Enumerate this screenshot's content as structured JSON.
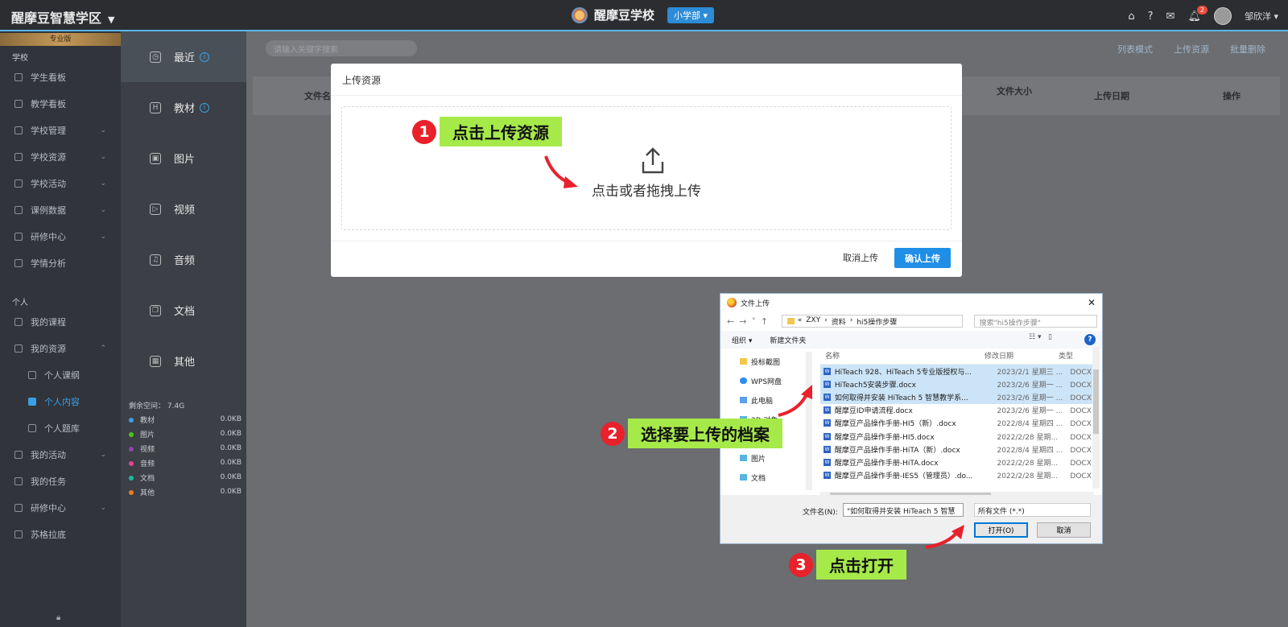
{
  "header": {
    "brand": "醒摩豆智慧学区",
    "school": "醒摩豆学校",
    "dept": "小学部",
    "notification_count": "2",
    "user": "邹欣洋"
  },
  "sidebar": {
    "edition": "专业版",
    "section_school": "学校",
    "school_items": [
      "学生看板",
      "教学看板",
      "学校管理",
      "学校资源",
      "学校活动",
      "课例数据",
      "研修中心",
      "学情分析"
    ],
    "section_personal": "个人",
    "personal_items": [
      "我的课程",
      "我的资源"
    ],
    "sub_items": [
      "个人课纲",
      "个人内容",
      "个人题库"
    ],
    "more_items": [
      "我的活动",
      "我的任务",
      "研修中心",
      "苏格拉底"
    ]
  },
  "categories": [
    "最近",
    "教材",
    "图片",
    "视频",
    "音频",
    "文档",
    "其他"
  ],
  "storage": {
    "label": "剩余空间：",
    "value": "7.4G",
    "rows": [
      {
        "name": "教材",
        "size": "0.0KB",
        "color": "#3aa0e8"
      },
      {
        "name": "图片",
        "size": "0.0KB",
        "color": "#52c41a"
      },
      {
        "name": "视频",
        "size": "0.0KB",
        "color": "#8e44ad"
      },
      {
        "name": "音频",
        "size": "0.0KB",
        "color": "#e84393"
      },
      {
        "name": "文档",
        "size": "0.0KB",
        "color": "#1abc9c"
      },
      {
        "name": "其他",
        "size": "0.0KB",
        "color": "#e67e22"
      }
    ]
  },
  "toolbar": {
    "search_placeholder": "请输入关键字搜索",
    "list_mode": "列表模式",
    "upload": "上传资源",
    "batch_delete": "批量删除"
  },
  "table": {
    "col_name": "文件名",
    "col_size": "文件大小",
    "col_date": "上传日期",
    "col_action": "操作"
  },
  "modal": {
    "title": "上传资源",
    "drop_text": "点击或者拖拽上传",
    "cancel": "取消上传",
    "confirm": "确认上传"
  },
  "callouts": {
    "step1_num": "1",
    "step1": "点击上传资源",
    "step2_num": "2",
    "step2": "选择要上传的档案",
    "step3_num": "3",
    "step3": "点击打开"
  },
  "file_dialog": {
    "title": "文件上传",
    "path": [
      "«",
      "ZXY",
      "›",
      "资料",
      "›",
      "hi5操作步骤"
    ],
    "search_placeholder": "搜索\"hi5操作步骤\"",
    "organize": "组织 ▾",
    "new_folder": "新建文件夹",
    "tree": [
      "投标截图",
      "WPS网盘",
      "此电脑",
      "3D 对象",
      "视频",
      "图片",
      "文档"
    ],
    "col_name": "名称",
    "col_date": "修改日期",
    "col_type": "类型",
    "files": [
      {
        "name": "HiTeach 928、HiTeach 5专业版授权与...",
        "date": "2023/2/1 星期三 ...",
        "type": "DOCX 文",
        "selected": true
      },
      {
        "name": "HiTeach5安装步骤.docx",
        "date": "2023/2/6 星期一 ...",
        "type": "DOCX 文",
        "selected": true
      },
      {
        "name": "如何取得并安装 HiTeach 5 智慧教学系...",
        "date": "2023/2/6 星期一 ...",
        "type": "DOCX 文",
        "selected": true
      },
      {
        "name": "醒摩豆ID申请流程.docx",
        "date": "2023/2/6 星期一 ...",
        "type": "DOCX 文",
        "selected": false
      },
      {
        "name": "醒摩豆产品操作手册-HI5（新）.docx",
        "date": "2022/8/4 星期四 ...",
        "type": "DOCX 文",
        "selected": false
      },
      {
        "name": "醒摩豆产品操作手册-HI5.docx",
        "date": "2022/2/28 星期...",
        "type": "DOCX 文",
        "selected": false
      },
      {
        "name": "醒摩豆产品操作手册-HiTA（新）.docx",
        "date": "2022/8/4 星期四 ...",
        "type": "DOCX 文",
        "selected": false
      },
      {
        "name": "醒摩豆产品操作手册-HiTA.docx",
        "date": "2022/2/28 星期...",
        "type": "DOCX 文",
        "selected": false
      },
      {
        "name": "醒摩豆产品操作手册-IES5（管理员）.do...",
        "date": "2022/2/28 星期...",
        "type": "DOCX 文",
        "selected": false
      }
    ],
    "filename_label": "文件名(N):",
    "filename_value": "\"如何取得并安装 HiTeach 5 智慧",
    "filter": "所有文件 (*.*)",
    "open": "打开(O)",
    "cancel": "取消"
  }
}
